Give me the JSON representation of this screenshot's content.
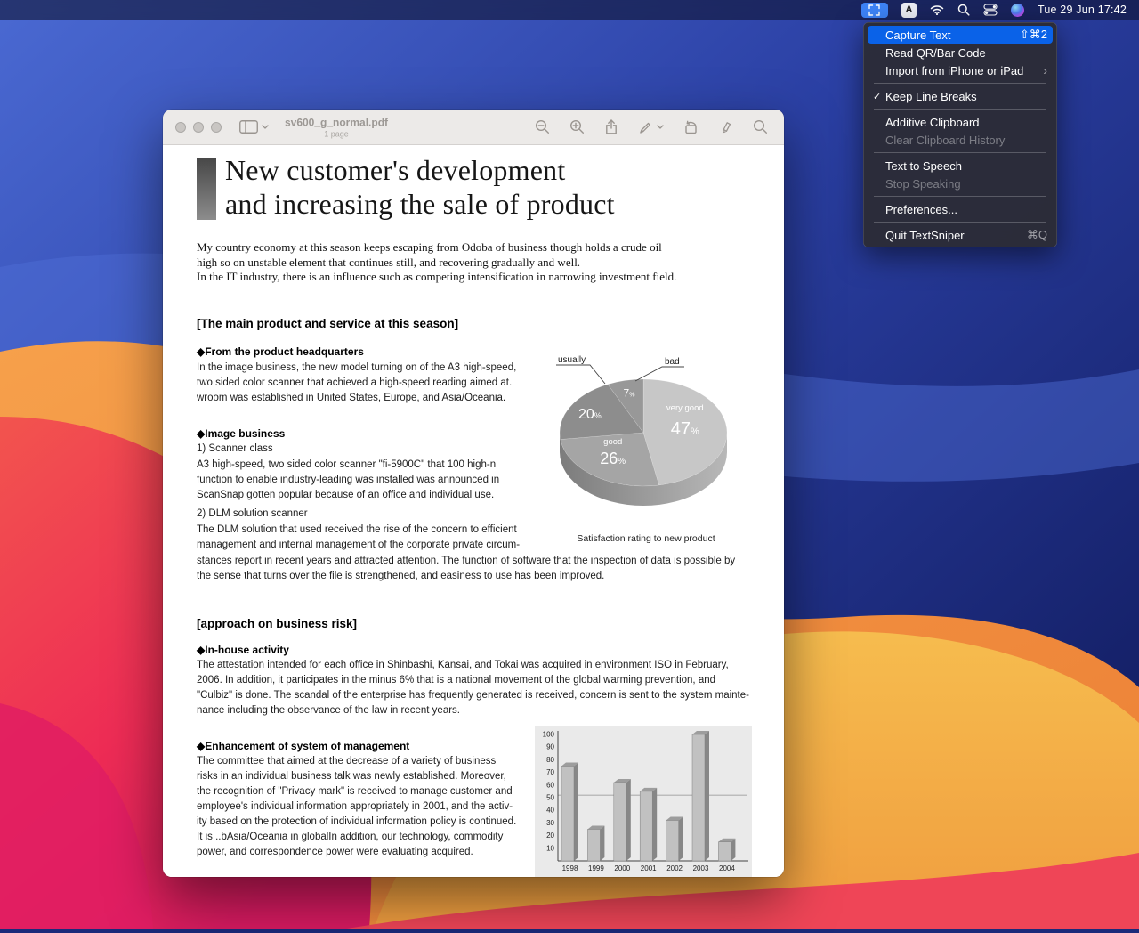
{
  "menu_bar": {
    "clock": "Tue 29 Jun 17:42",
    "icons": [
      "textsniper-capture-icon",
      "input-source-a-icon",
      "wifi-icon",
      "spotlight-search-icon",
      "control-center-icon",
      "siri-icon"
    ]
  },
  "textsniper_menu": {
    "items": [
      {
        "type": "item",
        "label": "Capture Text",
        "shortcut": "⇧⌘2",
        "state": "highlighted"
      },
      {
        "type": "item",
        "label": "Read QR/Bar Code"
      },
      {
        "type": "item",
        "label": "Import from iPhone or iPad",
        "submenu": true
      },
      {
        "type": "separator"
      },
      {
        "type": "item",
        "label": "Keep Line Breaks",
        "checked": true
      },
      {
        "type": "separator"
      },
      {
        "type": "item",
        "label": "Additive Clipboard"
      },
      {
        "type": "item",
        "label": "Clear Clipboard History",
        "disabled": true
      },
      {
        "type": "separator"
      },
      {
        "type": "item",
        "label": "Text to Speech"
      },
      {
        "type": "item",
        "label": "Stop Speaking",
        "disabled": true
      },
      {
        "type": "separator"
      },
      {
        "type": "item",
        "label": "Preferences..."
      },
      {
        "type": "separator"
      },
      {
        "type": "item",
        "label": "Quit TextSniper",
        "shortcut": "⌘Q"
      }
    ]
  },
  "window": {
    "title": "sv600_g_normal.pdf",
    "page_count": "1 page",
    "toolbar_icons": [
      "sidebar-icon",
      "chevron-down-icon",
      "zoom-out-icon",
      "zoom-in-icon",
      "share-icon",
      "markup-pen-icon",
      "markup-chevron-icon",
      "rotate-icon",
      "highlighter-icon",
      "search-icon"
    ]
  },
  "document": {
    "title_lines": [
      "New customer's development",
      "and increasing the sale of product"
    ],
    "intro": "My country economy at this season keeps escaping from Odoba of business though holds a crude oil\nhigh so on unstable element that continues still, and recovering gradually and well.\nIn the IT industry, there is an influence such as competing intensification in narrowing investment field.",
    "section_main": {
      "heading": "[The main product and service at this season]",
      "sub1_title": "◆From the product headquarters",
      "sub1_body": "In the image business, the new model turning on of the A3 high-speed,\ntwo sided color scanner that achieved a high-speed reading aimed at.\nwroom was established in United States, Europe, and Asia/Oceania.",
      "sub2_title": "◆Image business",
      "sub2_item1": "1) Scanner class",
      "sub2_body1": "A3 high-speed, two sided color scanner \"fi-5900C\" that 100 high-n\nfunction to enable industry-leading was installed was announced in\nScanSnap gotten popular because of an office and individual use.",
      "sub2_item2": "2) DLM solution scanner",
      "sub2_body2": "The DLM solution that used received the rise of the concern to efficient\nmanagement and internal management of the corporate private circum-",
      "sub2_body_full": "stances report in recent years and attracted attention. The function of software that the inspection of data is possible by\nthe sense that turns over the file is strengthened, and easiness to use has been improved."
    },
    "section_risk": {
      "heading": "[approach on business risk]",
      "sub1_title": "◆In-house activity",
      "sub1_body": "The attestation intended for each office in Shinbashi, Kansai, and Tokai was acquired in environment ISO in February,\n2006. In addition, it participates in the minus 6% that is a national movement of the global warming prevention, and\n\"Culbiz\" is done. The scandal of the enterprise has frequently generated is received, concern is sent to the system mainte-\nnance including the observance of the law in recent years.",
      "sub2_title": "◆Enhancement of system of management",
      "sub2_body": "The committee that aimed at the decrease of a variety of business\nrisks in an individual business talk was newly established. Moreover,\nthe recognition of \"Privacy mark\" is received to manage customer and\nemployee's individual information appropriately in 2001, and the activ-\nity based on the protection of individual information policy is continued.\nIt is ..bAsia/Oceania in globalIn addition, our technology, commodity\npower, and correspondence power were evaluating acquired."
    }
  },
  "chart_data": [
    {
      "type": "pie",
      "title": "Satisfaction rating to new product",
      "unit": "%",
      "slices": [
        {
          "label": "very good",
          "value": 47,
          "color": "#c7c7c7"
        },
        {
          "label": "good",
          "value": 26,
          "color": "#a5a5a5"
        },
        {
          "label": "usually",
          "value": 20,
          "color": "#8d8d8d"
        },
        {
          "label": "bad",
          "value": 7,
          "color": "#989898"
        }
      ],
      "callout_labels": [
        "usually",
        "bad"
      ],
      "style": "3d grayscale cylinder, clockwise from top"
    },
    {
      "type": "bar",
      "categories": [
        "1998",
        "1999",
        "2000",
        "2001",
        "2002",
        "2003",
        "2004"
      ],
      "values": [
        75,
        25,
        62,
        55,
        32,
        100,
        15
      ],
      "ylim": [
        0,
        100
      ],
      "ytick_step": 10,
      "gridline_y": 52,
      "xlabel": "",
      "ylabel": "",
      "style": "3d grayscale bars on gray panel"
    }
  ]
}
